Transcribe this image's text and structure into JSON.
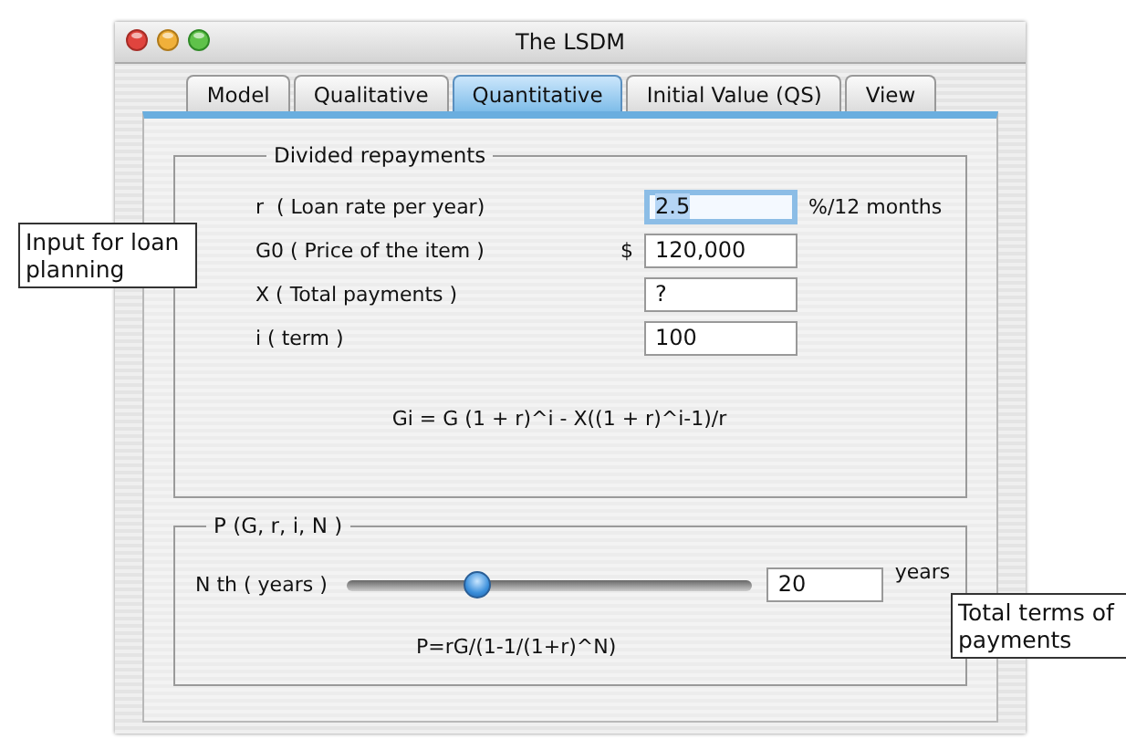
{
  "window": {
    "title": "The LSDM"
  },
  "tabs": [
    {
      "label": "Model",
      "selected": false
    },
    {
      "label": "Qualitative",
      "selected": false
    },
    {
      "label": "Quantitative",
      "selected": true
    },
    {
      "label": "Initial Value (QS)",
      "selected": false
    },
    {
      "label": "View",
      "selected": false
    }
  ],
  "divided_repayments": {
    "title": "Divided repayments",
    "fields": [
      {
        "label": "r  ( Loan rate per year)",
        "value": "2.5",
        "unit": "%/12 months",
        "focused": true
      },
      {
        "label": "G0 ( Price of the item )",
        "prefix": "$",
        "value": "120,000",
        "focused": false
      },
      {
        "label": "X ( Total payments )",
        "value": "?",
        "focused": false
      },
      {
        "label": "i ( term )",
        "value": "100",
        "focused": false
      }
    ],
    "formula": "Gi = G (1 + r)^i - X((1 + r)^i-1)/r"
  },
  "payment": {
    "title": "P (G, r, i, N )",
    "slider_label": "N th ( years )",
    "level": 0.32,
    "value": "20",
    "unit": "years",
    "formula": "P=rG/(1-1/(1+r)^N)"
  },
  "callouts": [
    {
      "text": "Input for loan planning"
    },
    {
      "text": "Total terms of payments"
    }
  ]
}
